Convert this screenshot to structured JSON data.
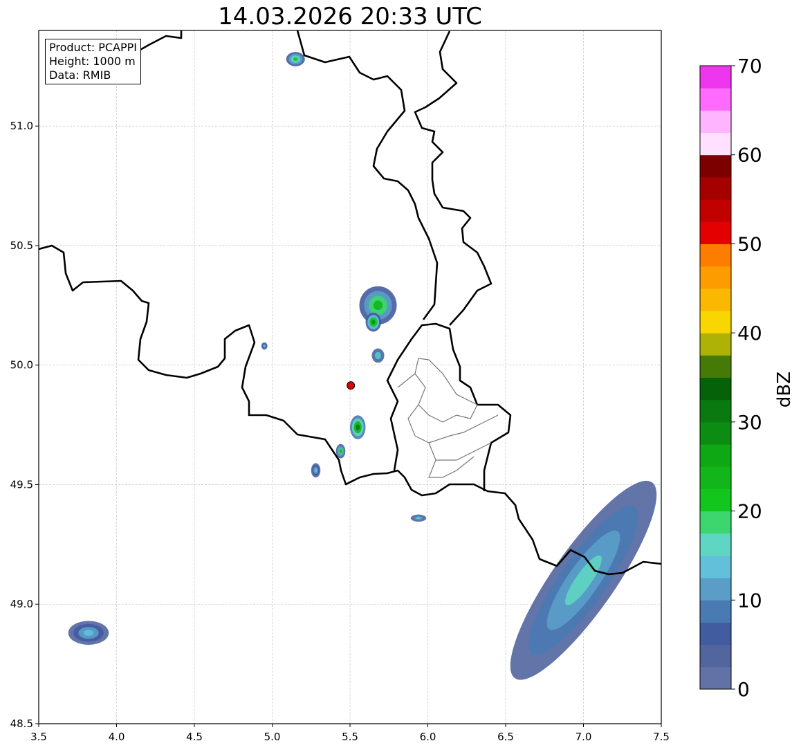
{
  "title": "14.03.2026 20:33 UTC",
  "info": {
    "product": "Product: PCAPPI",
    "height": "Height: 1000 m",
    "data": "Data: RMIB"
  },
  "map": {
    "lon_range": [
      3.5,
      7.5
    ],
    "lat_range": [
      48.5,
      51.4
    ],
    "x_ticks": [
      "3.5",
      "4.0",
      "4.5",
      "5.0",
      "5.5",
      "6.0",
      "6.5",
      "7.0",
      "7.5"
    ],
    "y_ticks": [
      "48.5",
      "49.0",
      "49.5",
      "50.0",
      "50.5",
      "51.0"
    ],
    "grid": "dashed",
    "radar_site": {
      "lon": 5.505,
      "lat": 49.915,
      "color": "#e00000"
    }
  },
  "colorbar": {
    "label": "dBZ",
    "vmin": 0,
    "vmax": 70,
    "ticks": [
      "0",
      "10",
      "20",
      "30",
      "40",
      "50",
      "60",
      "70"
    ],
    "colors": [
      "#6272a6",
      "#52659e",
      "#425ca0",
      "#4a7ab2",
      "#5a9ec8",
      "#62c0da",
      "#5ed6c2",
      "#3dd66e",
      "#12c61e",
      "#12b61a",
      "#0ea814",
      "#0c8c12",
      "#0a7a10",
      "#066208",
      "#467a06",
      "#aeb206",
      "#fad600",
      "#fbb800",
      "#fc9c00",
      "#fd7d00",
      "#e40000",
      "#c20000",
      "#a40000",
      "#7c0000",
      "#ffe0ff",
      "#ffb4ff",
      "#ff6aff",
      "#ee36ee"
    ]
  },
  "echoes": [
    {
      "name": "north-border",
      "lon": 5.15,
      "lat": 51.28,
      "rx": 0.06,
      "ry": 0.03,
      "max_dbz": 20
    },
    {
      "name": "ardennes-cluster-1",
      "lon": 5.68,
      "lat": 50.25,
      "rx": 0.12,
      "ry": 0.08,
      "max_dbz": 24
    },
    {
      "name": "ardennes-cluster-2",
      "lon": 5.65,
      "lat": 50.18,
      "rx": 0.05,
      "ry": 0.04,
      "max_dbz": 28
    },
    {
      "name": "small-cell-west",
      "lon": 4.95,
      "lat": 50.08,
      "rx": 0.02,
      "ry": 0.015,
      "max_dbz": 14
    },
    {
      "name": "cell-east",
      "lon": 5.68,
      "lat": 50.04,
      "rx": 0.04,
      "ry": 0.03,
      "max_dbz": 18
    },
    {
      "name": "cell-south-1",
      "lon": 5.55,
      "lat": 49.74,
      "rx": 0.05,
      "ry": 0.05,
      "max_dbz": 30
    },
    {
      "name": "cell-south-2",
      "lon": 5.44,
      "lat": 49.64,
      "rx": 0.03,
      "ry": 0.03,
      "max_dbz": 24
    },
    {
      "name": "cell-south-3",
      "lon": 5.28,
      "lat": 49.56,
      "rx": 0.03,
      "ry": 0.03,
      "max_dbz": 14
    },
    {
      "name": "cell-southeast",
      "lon": 5.94,
      "lat": 49.36,
      "rx": 0.05,
      "ry": 0.015,
      "max_dbz": 16
    },
    {
      "name": "southwest-cluster",
      "lon": 3.82,
      "lat": 48.88,
      "rx": 0.13,
      "ry": 0.05,
      "max_dbz": 14
    },
    {
      "name": "southeast-band",
      "lon": 7.0,
      "lat": 49.1,
      "rx": 0.2,
      "ry": 0.5,
      "max_dbz": 16
    }
  ]
}
